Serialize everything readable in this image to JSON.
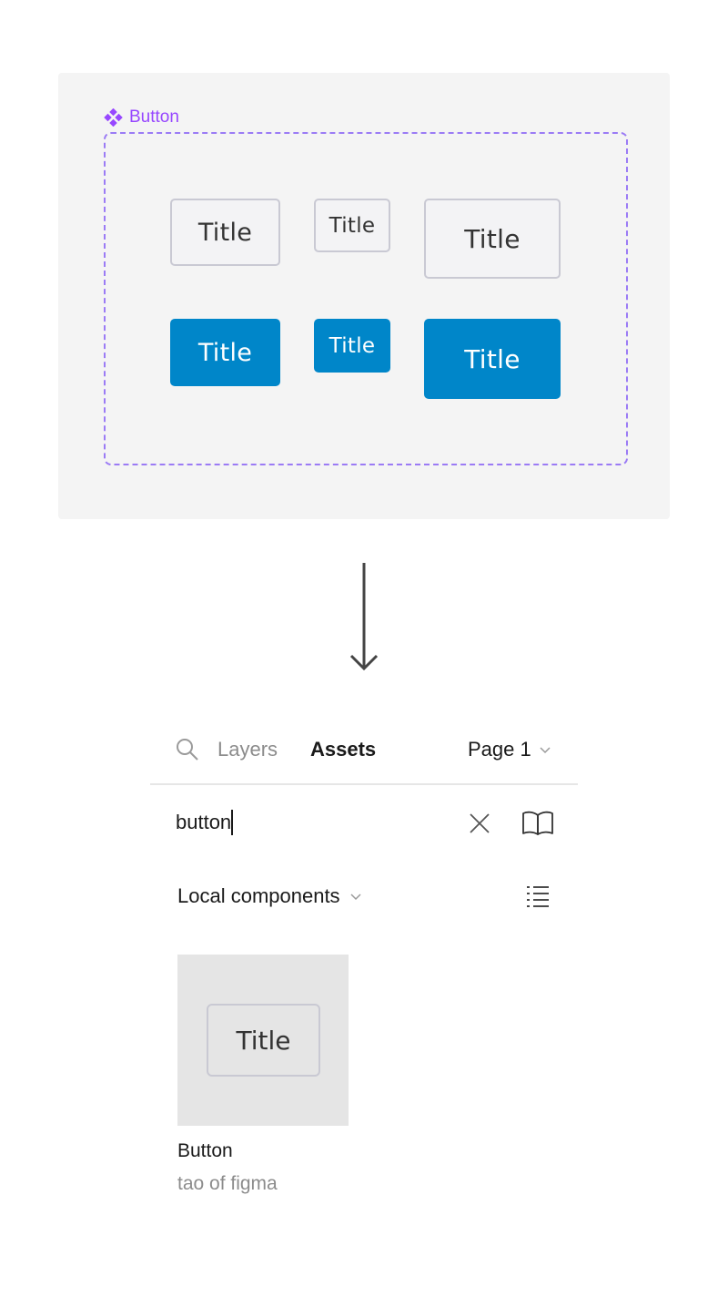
{
  "canvas": {
    "component_label": "Button",
    "buttons": [
      {
        "label": "Title",
        "variant": "secondary"
      },
      {
        "label": "Title",
        "variant": "secondary"
      },
      {
        "label": "Title",
        "variant": "secondary"
      },
      {
        "label": "Title",
        "variant": "primary"
      },
      {
        "label": "Title",
        "variant": "primary"
      },
      {
        "label": "Title",
        "variant": "primary"
      }
    ]
  },
  "panel": {
    "tabs": {
      "layers": "Layers",
      "assets": "Assets",
      "page": "Page 1"
    },
    "search": {
      "value": "button"
    },
    "section": {
      "label": "Local components"
    },
    "asset": {
      "thumbnail_label": "Title",
      "name": "Button",
      "source": "tao of figma"
    }
  },
  "colors": {
    "component_purple": "#9747ff",
    "primary_blue": "#0086c9",
    "canvas_bg": "#f4f4f4",
    "thumbnail_bg": "#e5e5e5"
  },
  "icons": {
    "component": "component-diamond-icon",
    "search": "search-icon",
    "chevron": "chevron-down-icon",
    "clear": "close-icon",
    "library": "book-icon",
    "list_view": "list-view-icon",
    "arrow": "arrow-down-icon"
  }
}
